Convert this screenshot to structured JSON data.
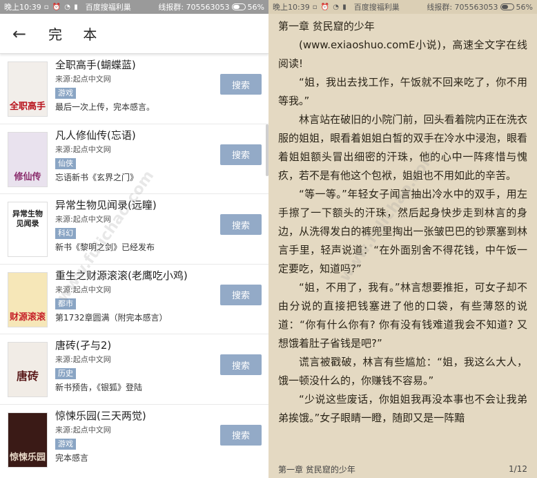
{
  "status_left": {
    "time": "晚上10:39",
    "app": "百度搜福利巢",
    "qq": "线报群: 705563053",
    "battery": "56%"
  },
  "status_right": {
    "time": "晚上10:39",
    "app": "百度搜福利巢",
    "qq": "线报群: 705563053",
    "battery": "56%"
  },
  "header": {
    "back_icon": "←",
    "title": "完 本"
  },
  "books": [
    {
      "title": "全职高手(蝴蝶蓝)",
      "source": "来源:起点中文网",
      "genre": "游戏",
      "desc": "最后一次上传，完本感言。",
      "button": "搜索",
      "cover_text": "全职高手",
      "cover_bg": "#f2eeea",
      "cover_fg": "#b8111b"
    },
    {
      "title": "凡人修仙传(忘语)",
      "source": "来源:起点中文网",
      "genre": "仙侠",
      "desc": "忘语新书《玄界之门》",
      "button": "搜索",
      "cover_text": "修仙传",
      "cover_bg": "#e9e2ee",
      "cover_fg": "#8a2c6c"
    },
    {
      "title": "异常生物见闻录(远瞳)",
      "source": "来源:起点中文网",
      "genre": "科幻",
      "desc": "新书《黎明之剑》已经发布",
      "button": "搜索",
      "cover_text": "异常生物见闻录",
      "cover_bg": "#ffffff",
      "cover_fg": "#222222"
    },
    {
      "title": "重生之财源滚滚(老鹰吃小鸡)",
      "source": "来源:起点中文网",
      "genre": "都市",
      "desc": "第1732章圆满（附完本感言）",
      "button": "搜索",
      "cover_text": "财源滚滚",
      "cover_bg": "#f6e7b8",
      "cover_fg": "#c6232a"
    },
    {
      "title": "唐砖(孑与2)",
      "source": "来源:起点中文网",
      "genre": "历史",
      "desc": "新书预告，《银狐》登陆",
      "button": "搜索",
      "cover_text": "唐砖",
      "cover_bg": "#f1ece6",
      "cover_fg": "#5a1a1a"
    },
    {
      "title": "惊悚乐园(三天两觉)",
      "source": "来源:起点中文网",
      "genre": "游戏",
      "desc": "完本感言",
      "button": "搜索",
      "cover_text": "惊悚乐园",
      "cover_bg": "#3a1a16",
      "cover_fg": "#e8d9c8"
    }
  ],
  "reader": {
    "chapter_title": "第一章 贫民窟的少年",
    "paragraphs": [
      "(www.exiaoshuo.comE小说)，高速全文字在线阅读!",
      "“姐，我出去找工作，午饭就不回来吃了，你不用等我。”",
      "林言站在破旧的小院门前，回头看着院内正在洗衣服的姐姐，眼看着姐姐白皙的双手在冷水中浸泡，眼看着姐姐额头冒出细密的汗珠，他的心中一阵疼惜与愧疚，若不是有他这个包袱，姐姐也不用如此的辛苦。",
      "“等一等。”年轻女子闻言抽出冷水中的双手，用左手擦了一下额头的汗珠，然后起身快步走到林言的身边，从洗得发白的裤兜里掏出一张皱巴巴的钞票塞到林言手里，轻声说道：“在外面别舍不得花钱，中午饭一定要吃，知道吗?”",
      "“姐，不用了，我有。”林言想要推拒，可女子却不由分说的直接把钱塞进了他的口袋，有些薄怒的说道：“你有什么你有? 你有没有钱难道我会不知道? 又想饿着肚子省钱是吧?”",
      "谎言被戳破，林言有些尴尬：“姐，我这么大人，饿一顿没什么的，你赚钱不容易。”",
      "“少说这些废话，你姐姐我再没本事也不会让我弟弟挨饿。”女子眼睛一瞪，随即又是一阵黯"
    ],
    "footer_chapter": "第一章 贫民窟的少年",
    "page_indicator": "1/12"
  },
  "watermark": "www.fulichao.com",
  "colors": {
    "search_button": "#93aac7",
    "genre_tag": "#8aa5c4",
    "reader_bg": "#e4d9c2",
    "status_bar_left": "#9a9a9a"
  }
}
